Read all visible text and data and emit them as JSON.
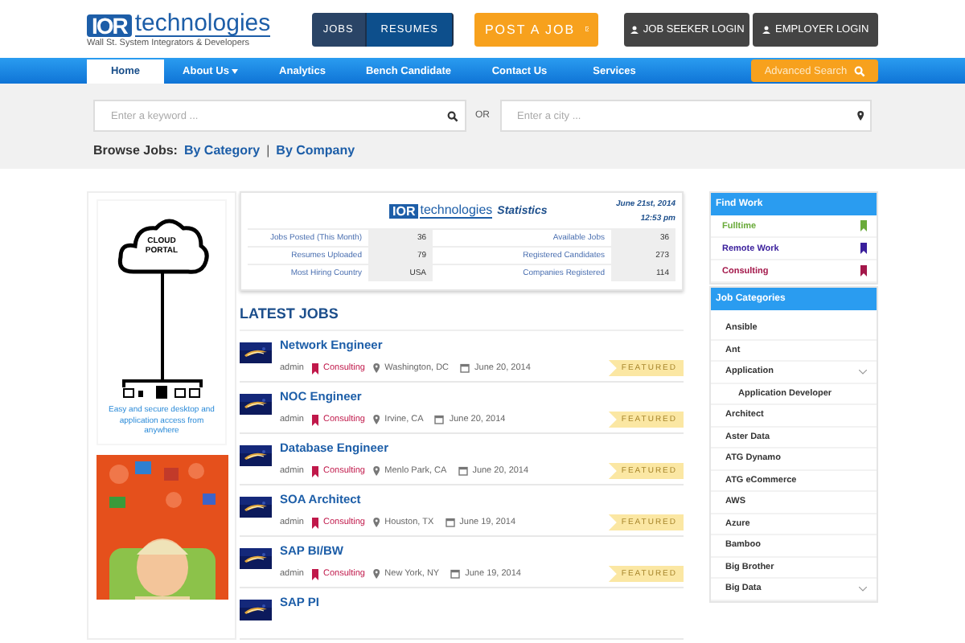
{
  "logo": {
    "mark": "IOR",
    "name": "technologies",
    "tagline": "Wall St. System Integrators & Developers"
  },
  "header_tabs": [
    {
      "label": "JOBS",
      "selected": false
    },
    {
      "label": "RESUMES",
      "selected": true
    }
  ],
  "post_button": "POST A JOB",
  "login_buttons": [
    "JOB SEEKER LOGIN",
    "EMPLOYER LOGIN"
  ],
  "nav": [
    {
      "label": "Home",
      "selected": true,
      "dropdown": false
    },
    {
      "label": "About Us",
      "selected": false,
      "dropdown": true
    },
    {
      "label": "Analytics",
      "selected": false,
      "dropdown": false
    },
    {
      "label": "Bench Candidate",
      "selected": false,
      "dropdown": false
    },
    {
      "label": "Contact Us",
      "selected": false,
      "dropdown": false
    },
    {
      "label": "Services",
      "selected": false,
      "dropdown": false
    }
  ],
  "advanced_search": "Advanced Search",
  "search": {
    "keyword_placeholder": "Enter a keyword ...",
    "or": "OR",
    "city_placeholder": "Enter a city ..."
  },
  "browse": {
    "label": "Browse Jobs:",
    "links": [
      "By Category",
      "By Company"
    ],
    "separator": "|"
  },
  "ad": {
    "title": "CLOUD PORTAL",
    "caption": "Easy and secure desktop and application access from anywhere"
  },
  "stats": {
    "logo_mark": "IOR",
    "logo_name": "technologies",
    "title": "Statistics",
    "date": "June 21st, 2014 12:53 pm",
    "rows": [
      {
        "label": "Jobs Posted (This Month)",
        "value": "36",
        "label2": "Available Jobs",
        "value2": "36"
      },
      {
        "label": "Resumes Uploaded",
        "value": "79",
        "label2": "Registered Candidates",
        "value2": "273"
      },
      {
        "label": "Most Hiring Country",
        "value": "USA",
        "label2": "Companies Registered",
        "value2": "114"
      }
    ]
  },
  "latest_jobs": {
    "title": "LATEST JOBS",
    "jobs": [
      {
        "title": "Network Engineer",
        "author": "admin",
        "type": "Consulting",
        "location": "Washington, DC",
        "date": "June 20, 2014",
        "badge": "FEATURED"
      },
      {
        "title": "NOC Engineer",
        "author": "admin",
        "type": "Consulting",
        "location": "Irvine, CA",
        "date": "June 20, 2014",
        "badge": "FEATURED"
      },
      {
        "title": "Database Engineer",
        "author": "admin",
        "type": "Consulting",
        "location": "Menlo Park, CA",
        "date": "June 20, 2014",
        "badge": "FEATURED"
      },
      {
        "title": "SOA Architect",
        "author": "admin",
        "type": "Consulting",
        "location": "Houston, TX",
        "date": "June 19, 2014",
        "badge": "FEATURED"
      },
      {
        "title": "SAP BI/BW",
        "author": "admin",
        "type": "Consulting",
        "location": "New York, NY",
        "date": "June 19, 2014",
        "badge": "FEATURED"
      },
      {
        "title": "SAP PI"
      }
    ]
  },
  "find_work": {
    "title": "Find Work",
    "items": [
      {
        "label": "Fulltime",
        "color": "#6aab3a"
      },
      {
        "label": "Remote Work",
        "color": "#3a1f9c"
      },
      {
        "label": "Consulting",
        "color": "#a3174a"
      }
    ]
  },
  "job_categories": {
    "title": "Job Categories",
    "items": [
      {
        "label": "Ansible",
        "expandable": false
      },
      {
        "label": "Ant",
        "expandable": false
      },
      {
        "label": "Application",
        "expandable": true,
        "children": [
          {
            "label": "Application Developer",
            "expandable": false
          }
        ]
      },
      {
        "label": "Architect",
        "expandable": false
      },
      {
        "label": "Aster Data",
        "expandable": false
      },
      {
        "label": "ATG Dynamo",
        "expandable": false
      },
      {
        "label": "ATG eCommerce",
        "expandable": false
      },
      {
        "label": "AWS",
        "expandable": false
      },
      {
        "label": "Azure",
        "expandable": false
      },
      {
        "label": "Bamboo",
        "expandable": false
      },
      {
        "label": "Big Brother",
        "expandable": false
      },
      {
        "label": "Big Data",
        "expandable": true
      }
    ]
  }
}
